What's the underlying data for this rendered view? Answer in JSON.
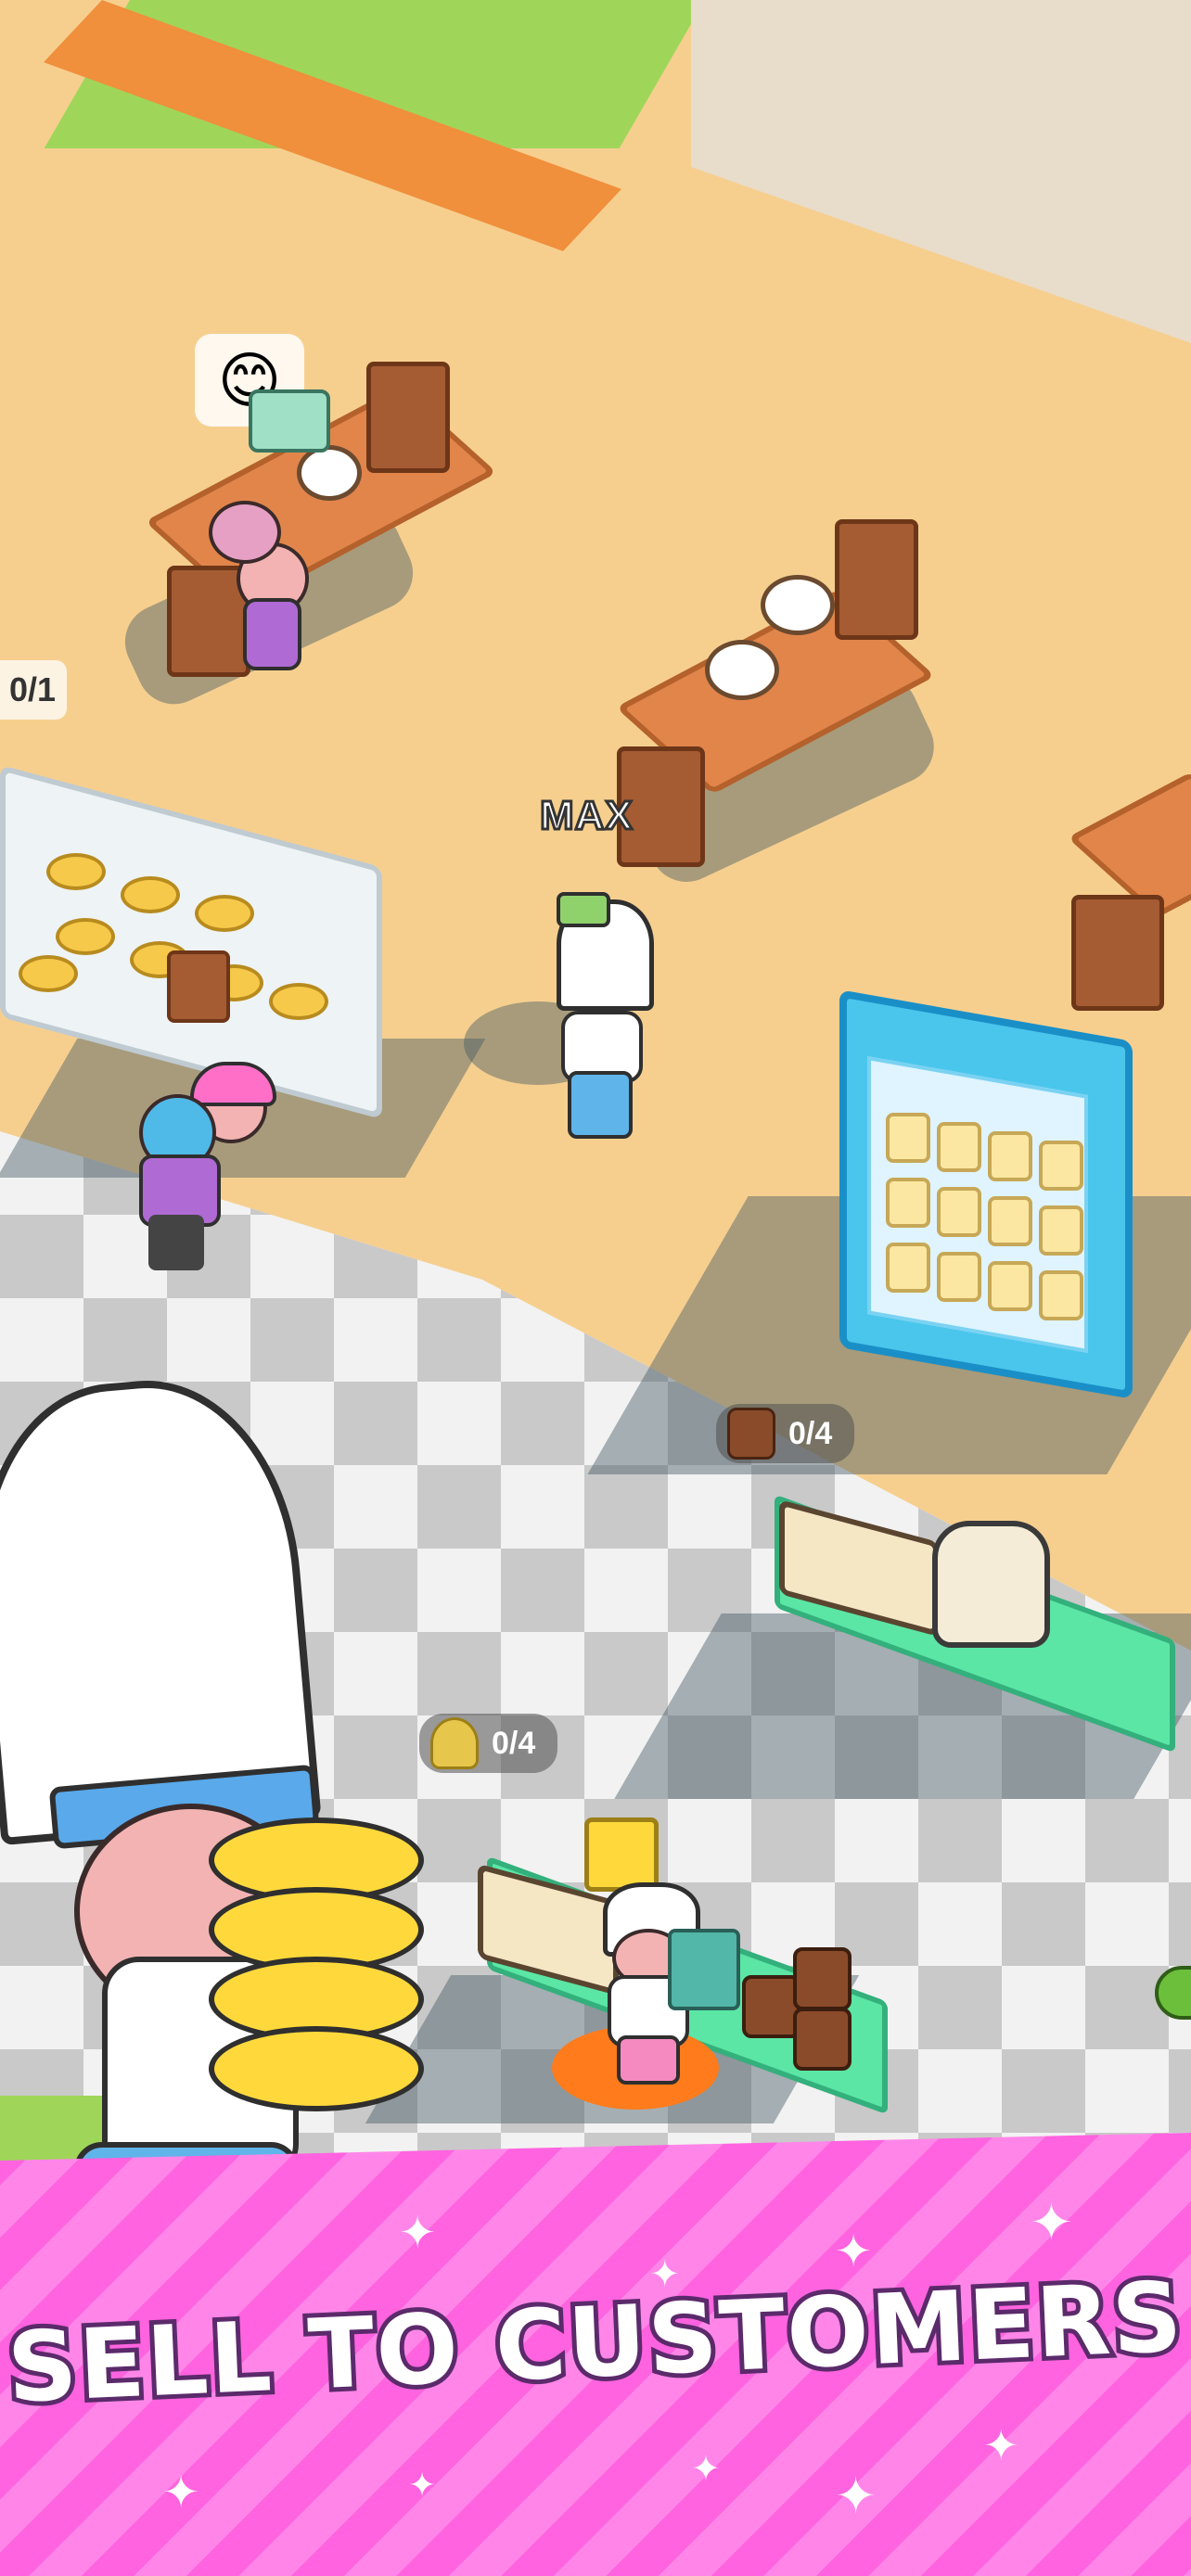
{
  "hud": {
    "left_progress": "0/1",
    "bread_counter": "0/4",
    "wheat_counter": "0/4",
    "player_name": "MAX",
    "happy_emoji": "😊",
    "bread_icon": "bread-icon",
    "wheat_icon": "wheat-icon"
  },
  "banner": {
    "title": "SELL TO CUSTOMERS",
    "sparkle": "✦"
  },
  "colors": {
    "floor": "#f6cf8f",
    "banner_pink": "#ff63df",
    "counter_green": "#5be6a5",
    "fridge_blue": "#4ac6ec"
  }
}
